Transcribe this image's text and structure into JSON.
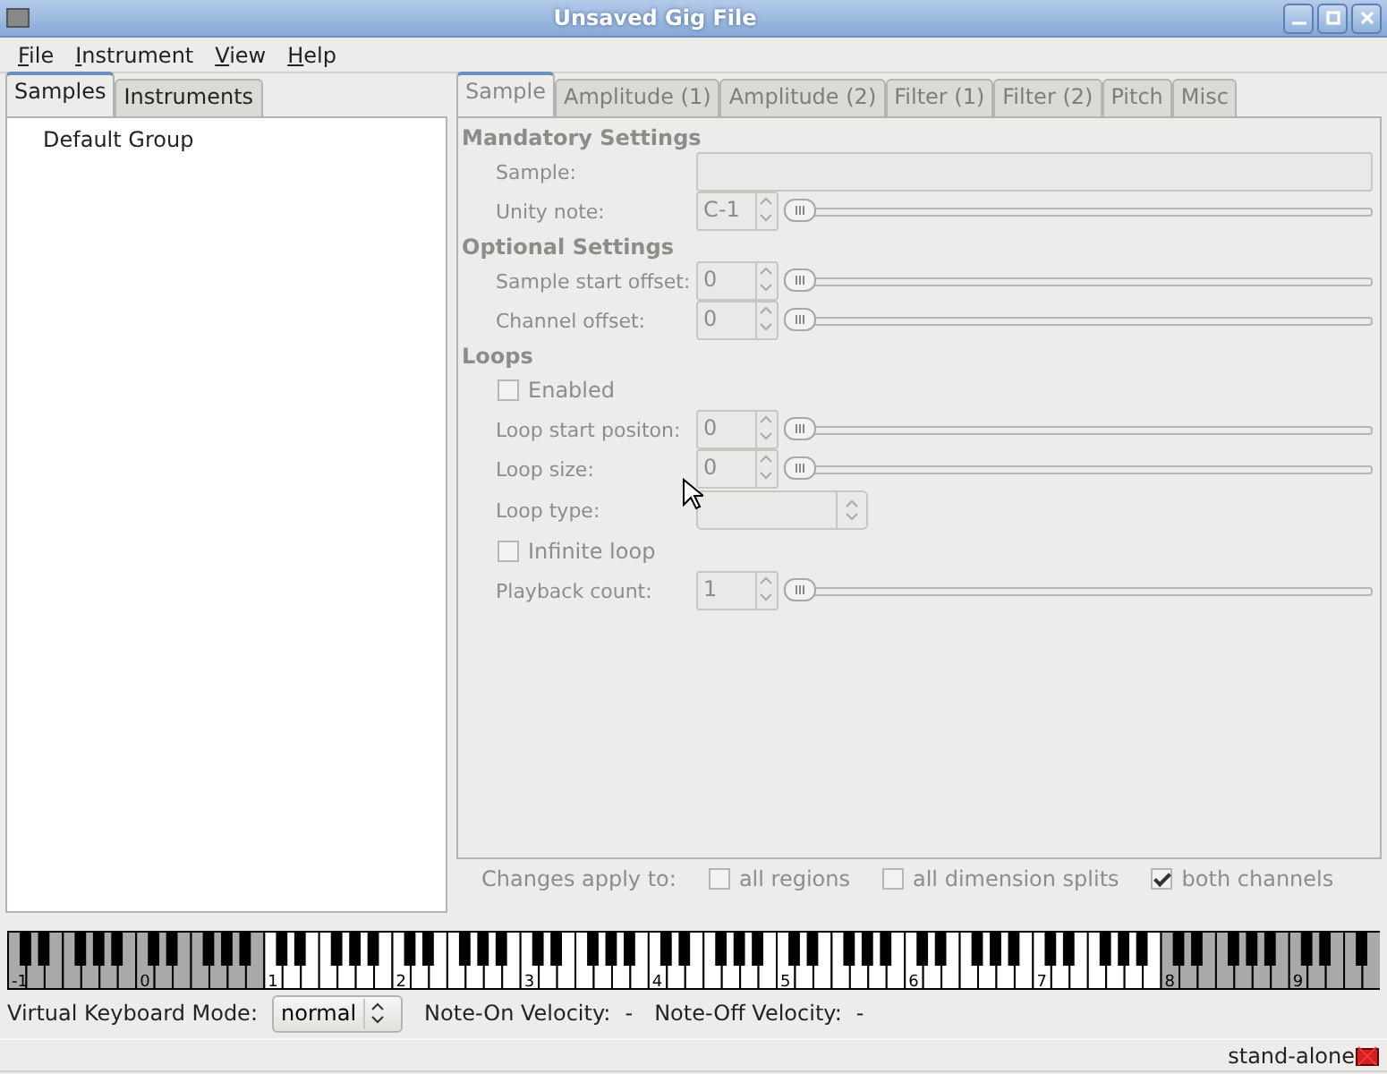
{
  "window": {
    "title": "Unsaved Gig File"
  },
  "menu": [
    {
      "label": "File"
    },
    {
      "label": "Instrument"
    },
    {
      "label": "View"
    },
    {
      "label": "Help"
    }
  ],
  "left_panel": {
    "tabs": [
      {
        "label": "Samples",
        "selected": true
      },
      {
        "label": "Instruments",
        "selected": false
      }
    ],
    "items": [
      {
        "label": "Default Group",
        "selected": false
      }
    ]
  },
  "editor": {
    "disabled": true,
    "tabs": [
      {
        "label": "Sample",
        "selected": true
      },
      {
        "label": "Amplitude (1)",
        "selected": false
      },
      {
        "label": "Amplitude (2)",
        "selected": false
      },
      {
        "label": "Filter (1)",
        "selected": false
      },
      {
        "label": "Filter (2)",
        "selected": false
      },
      {
        "label": "Pitch",
        "selected": false
      },
      {
        "label": "Misc",
        "selected": false
      }
    ],
    "rows": [
      {
        "kind": "heading",
        "label": "Mandatory Settings"
      },
      {
        "kind": "text",
        "label": "Sample:"
      },
      {
        "kind": "spin",
        "label": "Unity note:",
        "value": "C-1",
        "level": 0
      },
      {
        "kind": "heading",
        "label": "Optional Settings"
      },
      {
        "kind": "spin",
        "label": "Sample start offset:",
        "value": "0",
        "level": 0
      },
      {
        "kind": "spin",
        "label": "Channel offset:",
        "value": "0",
        "level": 0
      },
      {
        "kind": "heading",
        "label": "Loops"
      },
      {
        "kind": "checkbox",
        "label": "Enabled",
        "checked": false
      },
      {
        "kind": "spin",
        "label": "Loop start positon:",
        "value": "0",
        "level": 0
      },
      {
        "kind": "spin",
        "label": "Loop size:",
        "value": "0",
        "level": 0
      },
      {
        "kind": "combo",
        "label": "Loop type:"
      },
      {
        "kind": "checkbox",
        "label": "Infinite loop",
        "checked": false
      },
      {
        "kind": "spin",
        "label": "Playback count:",
        "value": "1",
        "level": 0
      }
    ]
  },
  "apply": {
    "label": "Changes apply to:",
    "options": [
      {
        "label": "all regions",
        "checked": false
      },
      {
        "label": "all dimension splits",
        "checked": false
      },
      {
        "label": "both channels",
        "checked": true
      }
    ]
  },
  "keyboard": {
    "octaves": [
      {
        "label": "-1",
        "disabled": true
      },
      {
        "label": "0",
        "disabled": true
      },
      {
        "label": "1",
        "disabled": false
      },
      {
        "label": "2",
        "disabled": false
      },
      {
        "label": "3",
        "disabled": false
      },
      {
        "label": "4",
        "disabled": false
      },
      {
        "label": "5",
        "disabled": false
      },
      {
        "label": "6",
        "disabled": false
      },
      {
        "label": "7",
        "disabled": false
      },
      {
        "label": "8",
        "disabled": true
      },
      {
        "label": "9",
        "disabled": true
      }
    ]
  },
  "footer": {
    "mode_label": "Virtual Keyboard Mode:",
    "mode_value": "normal",
    "note_on_label": "Note-On Velocity:",
    "note_on_value": "-",
    "note_off_label": "Note-Off Velocity:",
    "note_off_value": "-"
  },
  "status_bar": {
    "text": "stand-alone"
  }
}
